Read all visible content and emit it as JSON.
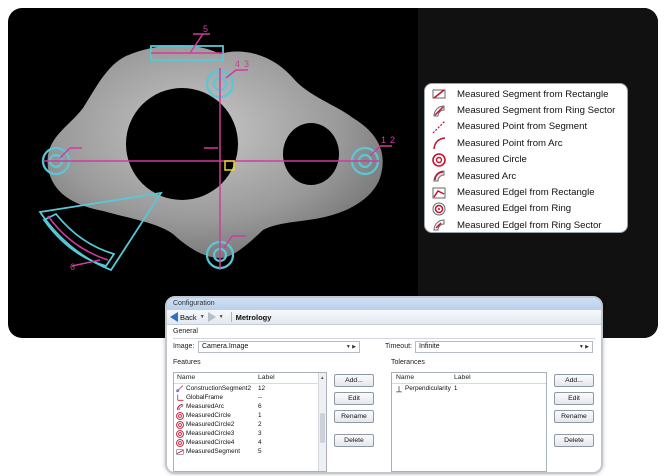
{
  "overlay": {
    "callouts": [
      "5",
      "4",
      "3",
      "1",
      "2",
      "6"
    ]
  },
  "legend": {
    "items": [
      {
        "label": "Measured Segment from Rectangle",
        "icon": "segment-rectangle-icon"
      },
      {
        "label": "Measured Segment from Ring Sector",
        "icon": "segment-ring-sector-icon"
      },
      {
        "label": "Measured Point from Segment",
        "icon": "point-segment-icon"
      },
      {
        "label": "Measured Point from Arc",
        "icon": "point-arc-icon"
      },
      {
        "label": "Measured Circle",
        "icon": "circle-icon"
      },
      {
        "label": "Measured Arc",
        "icon": "arc-icon"
      },
      {
        "label": "Measured Edgel from Rectangle",
        "icon": "edgel-rectangle-icon"
      },
      {
        "label": "Measured Edgel from Ring",
        "icon": "edgel-ring-icon"
      },
      {
        "label": "Measured Edgel from Ring Sector",
        "icon": "edgel-ring-sector-icon"
      }
    ]
  },
  "config": {
    "title": "Configuration",
    "toolbar": {
      "back": "Back",
      "breadcrumb": "Metrology"
    },
    "general": {
      "section": "General",
      "image_label": "Image:",
      "image_value": "Camera.Image",
      "timeout_label": "Timeout:",
      "timeout_value": "Infinite"
    },
    "features": {
      "section": "Features",
      "columns": [
        "Name",
        "Label"
      ],
      "rows": [
        {
          "name": "ConstructionSegment2",
          "label": "12",
          "icon": "construction-segment-icon"
        },
        {
          "name": "GlobalFrame",
          "label": "--",
          "icon": "frame-icon"
        },
        {
          "name": "MeasuredArc",
          "label": "6",
          "icon": "arc-icon"
        },
        {
          "name": "MeasuredCircle",
          "label": "1",
          "icon": "circle-icon"
        },
        {
          "name": "MeasuredCircle2",
          "label": "2",
          "icon": "circle-icon"
        },
        {
          "name": "MeasuredCircle3",
          "label": "3",
          "icon": "circle-icon"
        },
        {
          "name": "MeasuredCircle4",
          "label": "4",
          "icon": "circle-icon"
        },
        {
          "name": "MeasuredSegment",
          "label": "5",
          "icon": "segment-icon"
        }
      ],
      "buttons": {
        "add": "Add...",
        "edit": "Edit",
        "rename": "Rename",
        "delete": "Delete"
      }
    },
    "tolerances": {
      "section": "Tolerances",
      "columns": [
        "Name",
        "Label"
      ],
      "rows": [
        {
          "name": "Perpendicularity",
          "label": "1",
          "icon": "perpendicular-icon"
        }
      ],
      "buttons": {
        "add": "Add...",
        "edit": "Edit",
        "rename": "Rename",
        "delete": "Delete"
      }
    }
  },
  "colors": {
    "overlay_magenta": "#d03c9c",
    "overlay_cyan": "#58c8d8",
    "origin_yellow": "#e8d820"
  }
}
